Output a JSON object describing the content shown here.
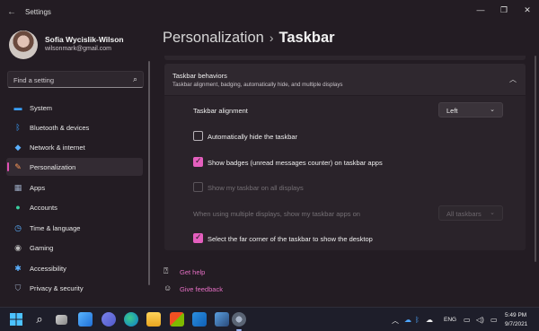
{
  "window": {
    "title": "Settings"
  },
  "user": {
    "name": "Sofia Wycislik-Wilson",
    "email": "wilsonmark@gmail.com"
  },
  "search": {
    "placeholder": "Find a setting"
  },
  "nav": {
    "items": [
      {
        "label": "System",
        "icon": "monitor-icon",
        "color": "#3aa0ff"
      },
      {
        "label": "Bluetooth & devices",
        "icon": "bluetooth-icon",
        "color": "#3aa0ff"
      },
      {
        "label": "Network & internet",
        "icon": "wifi-icon",
        "color": "#5ab0ff"
      },
      {
        "label": "Personalization",
        "icon": "brush-icon",
        "color": "#ff9a5a",
        "active": true
      },
      {
        "label": "Apps",
        "icon": "apps-icon",
        "color": "#9aa8c0"
      },
      {
        "label": "Accounts",
        "icon": "person-icon",
        "color": "#3ad0a0"
      },
      {
        "label": "Time & language",
        "icon": "globe-clock-icon",
        "color": "#5ab0ff"
      },
      {
        "label": "Gaming",
        "icon": "gamepad-icon",
        "color": "#bbbbbb"
      },
      {
        "label": "Accessibility",
        "icon": "accessibility-icon",
        "color": "#5ab0ff"
      },
      {
        "label": "Privacy & security",
        "icon": "shield-icon",
        "color": "#9aa8c0"
      }
    ]
  },
  "breadcrumb": {
    "parent": "Personalization",
    "separator": "›",
    "current": "Taskbar"
  },
  "section": {
    "title": "Taskbar behaviors",
    "subtitle": "Taskbar alignment, badging, automatically hide, and multiple displays"
  },
  "settings": {
    "alignment_label": "Taskbar alignment",
    "alignment_value": "Left",
    "autohide_label": "Automatically hide the taskbar",
    "autohide_checked": false,
    "badges_label": "Show badges (unread messages counter) on taskbar apps",
    "badges_checked": true,
    "all_displays_label": "Show my taskbar on all displays",
    "all_displays_checked": false,
    "multi_display_label": "When using multiple displays, show my taskbar apps on",
    "multi_display_value": "All taskbars",
    "far_corner_label": "Select the far corner of the taskbar to show the desktop",
    "far_corner_checked": true
  },
  "help": {
    "get_help": "Get help",
    "give_feedback": "Give feedback"
  },
  "taskbar": {
    "apps": [
      "start-icon",
      "search-icon",
      "task-view-icon",
      "widgets-icon",
      "chat-icon",
      "edge-icon",
      "file-explorer-icon",
      "store-icon",
      "mail-icon",
      "photos-icon",
      "settings-icon"
    ],
    "language": "ENG",
    "time": "5:49 PM",
    "date": "9/7/2021"
  },
  "accent": "#e45fbe"
}
